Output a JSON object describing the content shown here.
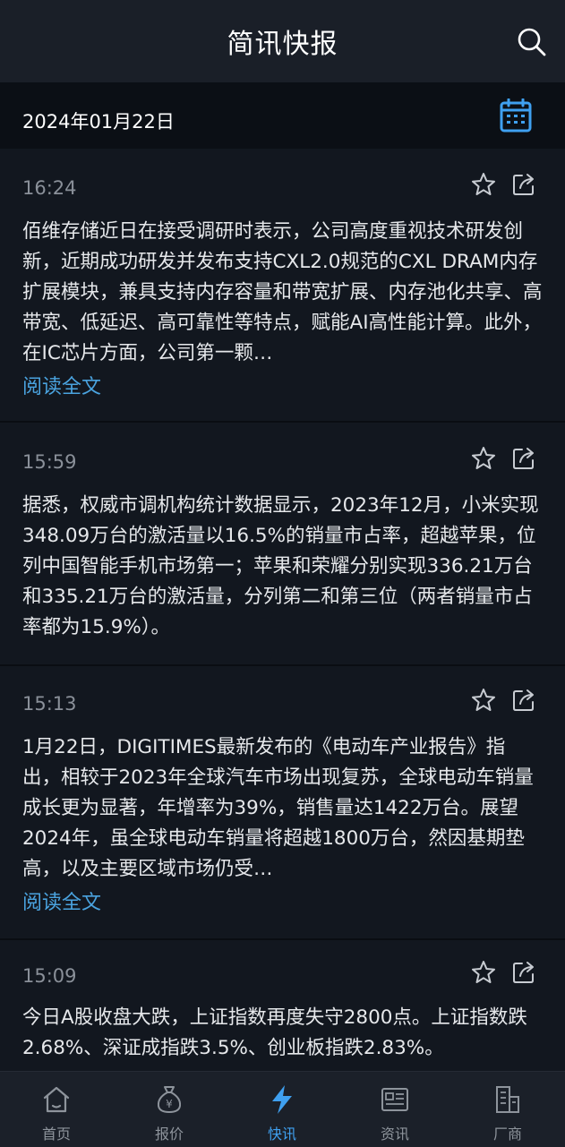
{
  "header": {
    "title": "简讯快报"
  },
  "date_bar": {
    "date": "2024年01月22日"
  },
  "feed": {
    "read_more_label": "阅读全文",
    "items": [
      {
        "time": "16:24",
        "text": "佰维存储近日在接受调研时表示，公司高度重视技术研发创新，近期成功研发并发布支持CXL2.0规范的CXL DRAM内存扩展模块，兼具支持内存容量和带宽扩展、内存池化共享、高带宽、低延迟、高可靠性等特点，赋能AI高性能计算。此外，在IC芯片方面，公司第一颗…"
      },
      {
        "time": "15:59",
        "text": "据悉，权威市调机构统计数据显示，2023年12月，小米实现348.09万台的激活量以16.5%的销量市占率，超越苹果，位列中国智能手机市场第一；苹果和荣耀分别实现336.21万台和335.21万台的激活量，分列第二和第三位（两者销量市占率都为15.9%）。"
      },
      {
        "time": "15:13",
        "text": "1月22日，DIGITIMES最新发布的《电动车产业报告》指出，相较于2023年全球汽车市场出现复苏，全球电动车销量成长更为显著，年增率为39%，销售量达1422万台。展望2024年，虽全球电动车销量将超越1800万台，然因基期垫高，以及主要区域市场仍受…"
      },
      {
        "time": "15:09",
        "text": "今日A股收盘大跌，上证指数再度失守2800点。上证指数跌2.68%、深证成指跌3.5%、创业板指跌2.83%。"
      }
    ]
  },
  "tabbar": {
    "tabs": [
      {
        "label": "首页",
        "icon": "home-icon"
      },
      {
        "label": "报价",
        "icon": "money-bag-icon"
      },
      {
        "label": "快讯",
        "icon": "lightning-icon"
      },
      {
        "label": "资讯",
        "icon": "news-icon"
      },
      {
        "label": "厂商",
        "icon": "building-icon"
      }
    ],
    "active": "快讯"
  },
  "colors": {
    "accent": "#3fa0f0",
    "link": "#4aa3df",
    "background": "#0f141c"
  }
}
